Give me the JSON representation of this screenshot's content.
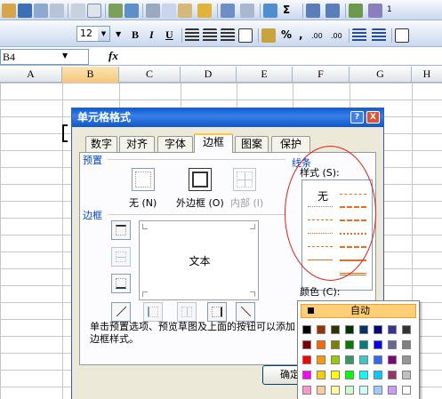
{
  "toolbar": {
    "font_size": "12",
    "bold": "B",
    "italic": "I",
    "underline": "U",
    "sigma": "Σ",
    "percent": "%",
    "comma": ",",
    "inc_decimal": ".00 →.0",
    "dec_decimal": ".00",
    "trail_glyph": "1"
  },
  "formula_bar": {
    "name_box": "B4",
    "fx": "fx"
  },
  "columns": [
    "A",
    "B",
    "C",
    "D",
    "E",
    "F",
    "G",
    "H"
  ],
  "dialog": {
    "title": "单元格格式",
    "help_glyph": "?",
    "close_glyph": "X",
    "tabs": [
      "数字",
      "对齐",
      "字体",
      "边框",
      "图案",
      "保护"
    ],
    "active_tab": "边框",
    "preset_group": "预置",
    "presets": [
      "无 (N)",
      "外边框 (O)",
      "内部 (I)"
    ],
    "border_group": "边框",
    "preview_text": "文本",
    "line_group": "线条",
    "style_label": "样式 (S):",
    "style_none": "无",
    "color_label": "颜色 (C):",
    "color_value": "自动",
    "info_text": "单击预置选项、预览草图及上面的按钮可以添加边框样式。",
    "ok": "确定"
  },
  "palette": {
    "auto_label": "自动",
    "rows": [
      [
        "#000000",
        "#993300",
        "#333300",
        "#003300",
        "#003366",
        "#000080",
        "#333399",
        "#333333"
      ],
      [
        "#800000",
        "#ff6600",
        "#808000",
        "#008000",
        "#008080",
        "#0000ff",
        "#666699",
        "#808080"
      ],
      [
        "#ff0000",
        "#ff9900",
        "#99cc00",
        "#339966",
        "#33cccc",
        "#3366ff",
        "#800080",
        "#969696"
      ],
      [
        "#ff00ff",
        "#ffcc00",
        "#ffff00",
        "#00ff00",
        "#00ffff",
        "#00ccff",
        "#993366",
        "#c0c0c0"
      ],
      [
        "#ff99cc",
        "#ffcc99",
        "#ffff99",
        "#ccffcc",
        "#ccffff",
        "#99ccff",
        "#cc99ff",
        "#ffffff"
      ]
    ]
  },
  "accent": {
    "annotation_ellipse": "#e02020",
    "dialog_title": "#0a5fd6",
    "auto_highlight": "#ffcf78"
  }
}
